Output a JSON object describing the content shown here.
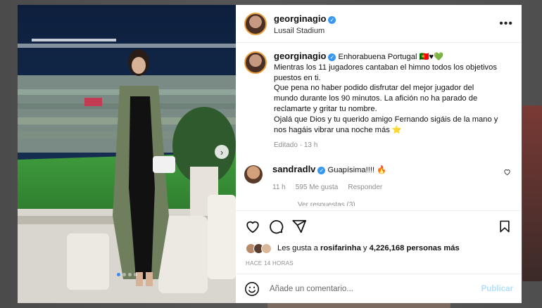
{
  "post": {
    "username": "georginagio",
    "location": "Lusail Stadium",
    "more_icon": "more-horizontal-icon",
    "verified_icon": "verified-badge-icon"
  },
  "caption": {
    "username": "georginagio",
    "lines": [
      "Enhorabuena Portugal 🇵🇹♥💚",
      "Mientras los 11 jugadores cantaban el himno todos los objetivos",
      "puestos en ti.",
      "Que pena no haber podido disfrutar del mejor jugador del",
      "mundo durante los 90 minutos. La afición no ha parado de",
      "reclamarte y gritar tu nombre.",
      "Ojalá que Dios y tu querido amigo Fernando sigáis de la mano y",
      "nos hagáis vibrar una noche más ⭐"
    ],
    "edited": "Editado",
    "age": "13 h"
  },
  "comment": {
    "username": "sandradlv",
    "text": "Guapísima!!!! 🔥",
    "age": "11 h",
    "likes": "595 Me gusta",
    "reply": "Responder",
    "view_replies": "Ver respuestas (3)"
  },
  "actions": [
    "heart-icon",
    "comment-icon",
    "share-icon",
    "bookmark-icon"
  ],
  "likes": {
    "prefix": "Les gusta a",
    "user": "rosifarinha",
    "connector": "y",
    "count": "4,226,168 personas más"
  },
  "timestamp": "HACE 14 HORAS",
  "composer": {
    "placeholder": "Añade un comentario...",
    "publish": "Publicar",
    "emoji_icon": "emoji-icon"
  },
  "carousel": {
    "slides": 4,
    "active": 1
  },
  "colors": {
    "accent": "#3897f0",
    "publish_disabled": "#b2dffc",
    "dress": "#6f7f5e"
  }
}
